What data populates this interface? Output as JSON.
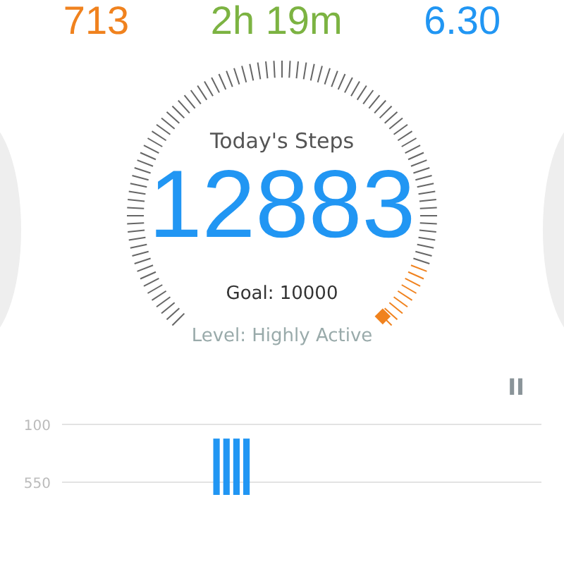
{
  "stats": [
    {
      "value": "713",
      "color": "#f0821e"
    },
    {
      "value": "2h 19m",
      "color": "#7cb342"
    },
    {
      "value": "6.30",
      "color": "#2196f3"
    }
  ],
  "gauge": {
    "title": "Today's Steps",
    "steps": "12883",
    "goal": "Goal: 10000"
  },
  "activity_level": "Level: Highly Active",
  "pause_button": {
    "symbol": "II"
  },
  "chart": {
    "axis_labels": [
      "100",
      "550"
    ]
  }
}
